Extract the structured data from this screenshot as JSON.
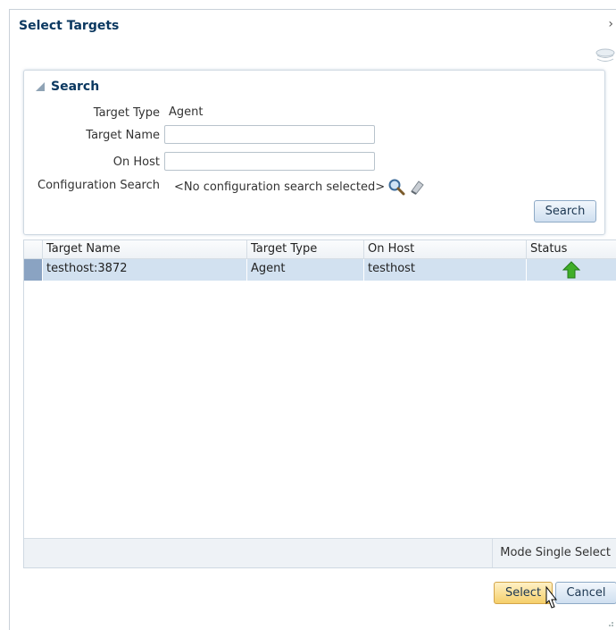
{
  "dialog": {
    "title": "Select Targets",
    "close_icon": "close-icon"
  },
  "search": {
    "header": "Search",
    "target_type_label": "Target Type",
    "target_type_value": "Agent",
    "target_name_label": "Target Name",
    "target_name_value": "",
    "on_host_label": "On Host",
    "on_host_value": "",
    "config_search_label": "Configuration Search",
    "config_search_value": "<No configuration search selected>",
    "search_button": "Search"
  },
  "table": {
    "columns": [
      "Target Name",
      "Target Type",
      "On Host",
      "Status"
    ],
    "rows": [
      {
        "target_name": "testhost:3872",
        "target_type": "Agent",
        "on_host": "testhost",
        "status": "up"
      }
    ],
    "mode_label": "Mode",
    "mode_value": "Single Select"
  },
  "footer": {
    "select_button": "Select",
    "cancel_button": "Cancel"
  },
  "colors": {
    "title": "#0b3860",
    "selected_row": "#d2e1f0",
    "status_up": "#3fae29",
    "primary_button": "#f5cf6a"
  }
}
